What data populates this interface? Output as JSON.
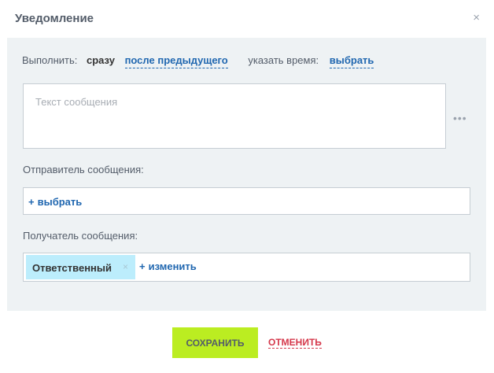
{
  "dialog": {
    "title": "Уведомление",
    "close": "×"
  },
  "execute": {
    "label": "Выполнить:",
    "now": "сразу",
    "after_previous": "после предыдущего",
    "time_label": "указать время:",
    "time_select": "выбрать"
  },
  "message": {
    "placeholder": "Текст сообщения",
    "more": "•••"
  },
  "sender": {
    "label": "Отправитель сообщения:",
    "add_plus": "+",
    "add_label": "выбрать"
  },
  "recipient": {
    "label": "Получатель сообщения:",
    "chip_label": "Ответственный",
    "chip_remove": "×",
    "change_plus": "+",
    "change_label": "изменить"
  },
  "buttons": {
    "save": "СОХРАНИТЬ",
    "cancel": "ОТМЕНИТЬ"
  },
  "colors": {
    "accent": "#2067b0",
    "save_bg": "#bbed21",
    "cancel": "#d5374a",
    "chip_bg": "#bcedfc",
    "panel_bg": "#eef2f4"
  }
}
